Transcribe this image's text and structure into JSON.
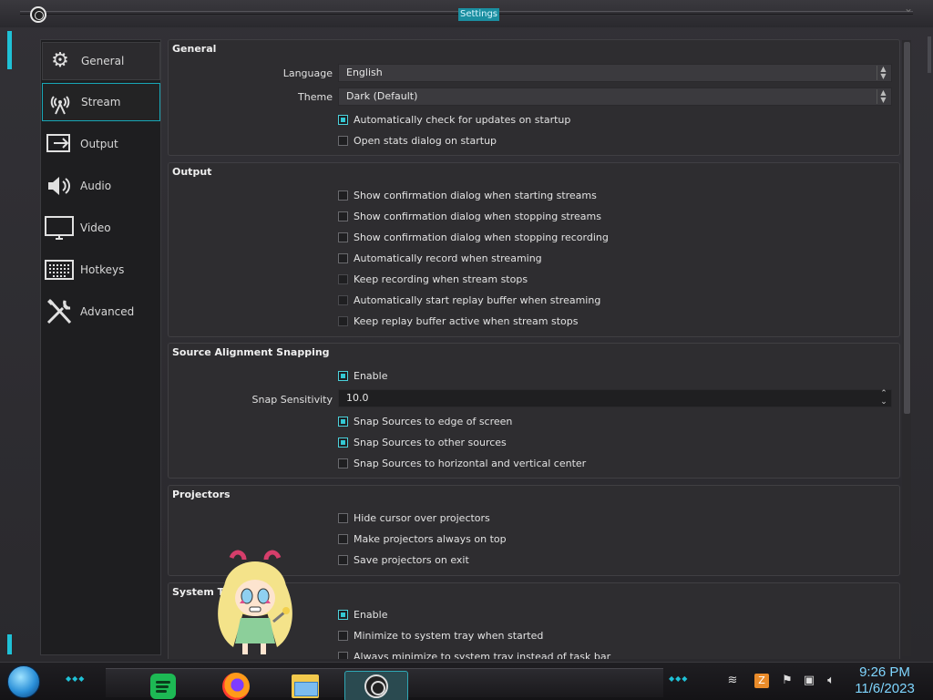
{
  "window": {
    "title": "Settings"
  },
  "sidebar": {
    "items": [
      {
        "label": "General",
        "icon": "gear-icon"
      },
      {
        "label": "Stream",
        "icon": "broadcast-icon"
      },
      {
        "label": "Output",
        "icon": "output-icon"
      },
      {
        "label": "Audio",
        "icon": "speaker-icon"
      },
      {
        "label": "Video",
        "icon": "monitor-icon"
      },
      {
        "label": "Hotkeys",
        "icon": "keyboard-icon"
      },
      {
        "label": "Advanced",
        "icon": "tools-icon"
      }
    ],
    "selected": "Stream"
  },
  "general": {
    "title": "General",
    "language_label": "Language",
    "language_value": "English",
    "theme_label": "Theme",
    "theme_value": "Dark (Default)",
    "checks": [
      {
        "label": "Automatically check for updates on startup",
        "checked": true
      },
      {
        "label": "Open stats dialog on startup",
        "checked": false
      }
    ]
  },
  "output": {
    "title": "Output",
    "checks": [
      {
        "label": "Show confirmation dialog when starting streams",
        "checked": false
      },
      {
        "label": "Show confirmation dialog when stopping streams",
        "checked": false
      },
      {
        "label": "Show confirmation dialog when stopping recording",
        "checked": false
      },
      {
        "label": "Automatically record when streaming",
        "checked": false
      },
      {
        "label": "Keep recording when stream stops",
        "checked": false,
        "disabled": true
      },
      {
        "label": "Automatically start replay buffer when streaming",
        "checked": false,
        "disabled": true
      },
      {
        "label": "Keep replay buffer active when stream stops",
        "checked": false,
        "disabled": true
      }
    ]
  },
  "snapping": {
    "title": "Source Alignment Snapping",
    "enable_label": "Enable",
    "enable_checked": true,
    "sensitivity_label": "Snap Sensitivity",
    "sensitivity_value": "10.0",
    "checks": [
      {
        "label": "Snap Sources to edge of screen",
        "checked": true
      },
      {
        "label": "Snap Sources to other sources",
        "checked": true
      },
      {
        "label": "Snap Sources to horizontal and vertical center",
        "checked": false
      }
    ]
  },
  "projectors": {
    "title": "Projectors",
    "checks": [
      {
        "label": "Hide cursor over projectors",
        "checked": false
      },
      {
        "label": "Make projectors always on top",
        "checked": false
      },
      {
        "label": "Save projectors on exit",
        "checked": false
      }
    ]
  },
  "system_tray": {
    "title": "System T",
    "checks": [
      {
        "label": "Enable",
        "checked": true
      },
      {
        "label": "Minimize to system tray when started",
        "checked": false
      },
      {
        "label": "Always minimize to system tray instead of task bar",
        "checked": false
      }
    ]
  },
  "taskbar": {
    "apps": [
      "spotify-icon",
      "firefox-icon",
      "file-explorer-icon",
      "obs-icon"
    ],
    "tray_icons": [
      "network-icon",
      "flag-icon",
      "app-tray-icon",
      "volume-icon"
    ],
    "time": "9:26 PM",
    "date": "11/6/2023"
  },
  "colors": {
    "accent": "#1fc1d6",
    "check_on": "#33c8d3",
    "bg": "#2e2d30",
    "sidebar_bg": "#1e1e20"
  }
}
